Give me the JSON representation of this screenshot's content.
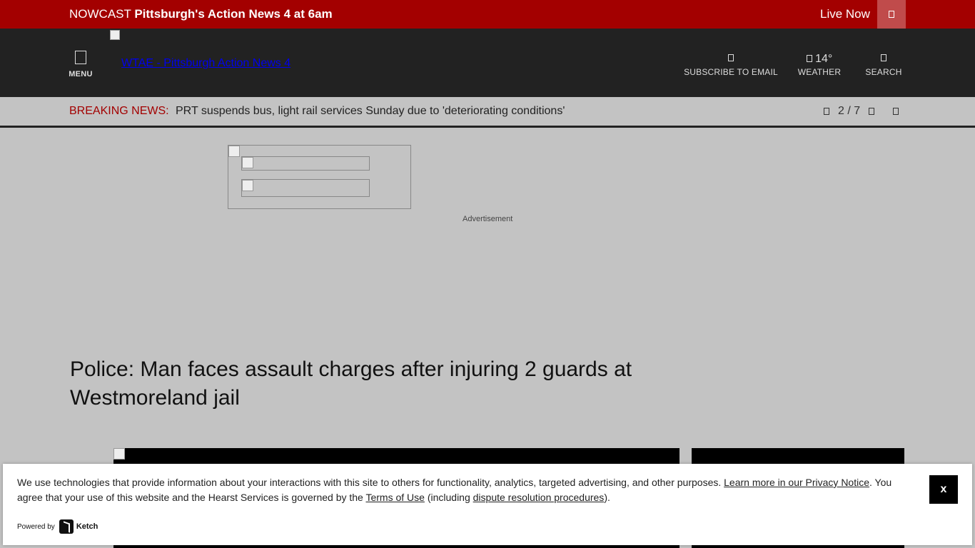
{
  "livebar": {
    "nowcast_prefix": "NOWCAST",
    "nowcast_title": "Pittsburgh's Action News 4 at 6am",
    "live_now": "Live Now",
    "accent_color": "#a30000"
  },
  "header": {
    "menu_label": "MENU",
    "logo_alt": "WTAE - Pittsburgh Action News 4",
    "subscribe_label": "SUBSCRIBE TO EMAIL",
    "weather_temp": "14°",
    "weather_label": "WEATHER",
    "search_label": "SEARCH"
  },
  "breaking": {
    "label": "BREAKING NEWS:",
    "text": "PRT suspends bus, light rail services Sunday due to 'deteriorating conditions'",
    "pager": "2 / 7"
  },
  "ad": {
    "label": "Advertisement"
  },
  "article": {
    "headline": "Police: Man faces assault charges after injuring 2 guards at Westmoreland jail"
  },
  "consent": {
    "text_part1": "We use technologies that provide information about your interactions with this site to others for functionality, analytics, targeted advertising, and other purposes. ",
    "privacy_link": "Learn more in our Privacy Notice",
    "text_part2": ". You agree that your use of this website and the Hearst Services is governed by the ",
    "terms_link": "Terms of Use",
    "text_part3": " (including ",
    "dispute_link": "dispute resolution procedures",
    "text_part4": ").",
    "close_label": "x",
    "powered_by": "Powered by",
    "brand": "Ketch"
  }
}
